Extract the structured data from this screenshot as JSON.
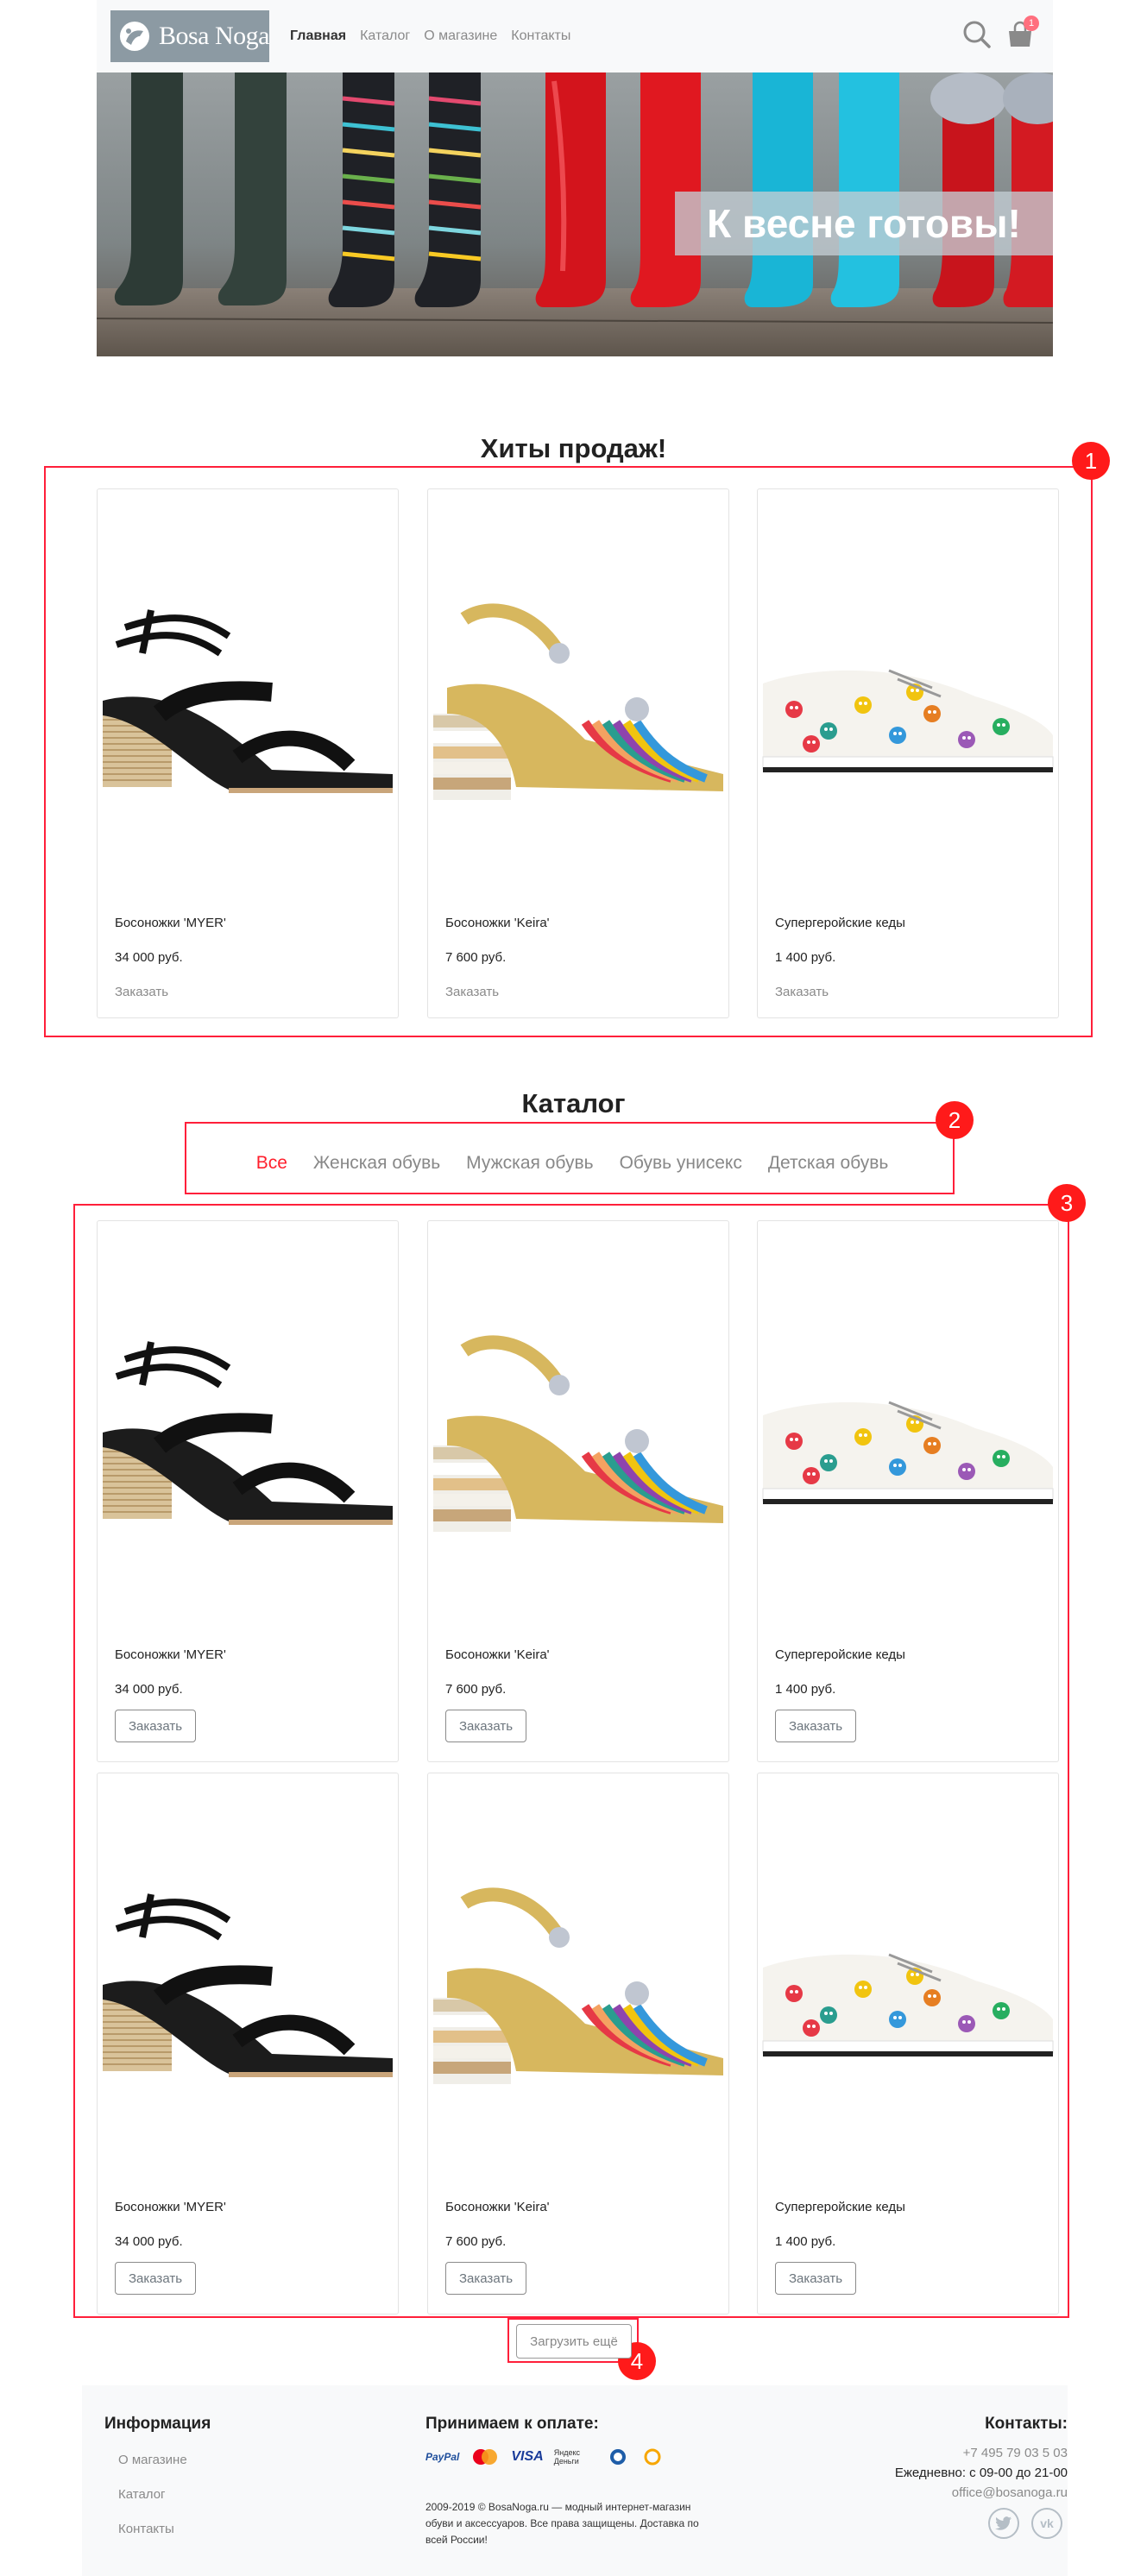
{
  "header": {
    "logo_text": "Bosa Noga",
    "nav": [
      "Главная",
      "Каталог",
      "О магазине",
      "Контакты"
    ],
    "cart_count": "1"
  },
  "banner": {
    "text": "К весне готовы!"
  },
  "bestsellers": {
    "title": "Хиты продаж!",
    "items": [
      {
        "name": "Босоножки 'MYER'",
        "price": "34 000 руб.",
        "order": "Заказать"
      },
      {
        "name": "Босоножки 'Keira'",
        "price": "7 600 руб.",
        "order": "Заказать"
      },
      {
        "name": "Супергеройские кеды",
        "price": "1 400 руб.",
        "order": "Заказать"
      }
    ]
  },
  "catalog": {
    "title": "Каталог",
    "tabs": [
      "Все",
      "Женская обувь",
      "Мужская обувь",
      "Обувь унисекс",
      "Детская обувь"
    ],
    "items": [
      {
        "name": "Босоножки 'MYER'",
        "price": "34 000 руб.",
        "order": "Заказать"
      },
      {
        "name": "Босоножки 'Keira'",
        "price": "7 600 руб.",
        "order": "Заказать"
      },
      {
        "name": "Супергеройские кеды",
        "price": "1 400 руб.",
        "order": "Заказать"
      },
      {
        "name": "Босоножки 'MYER'",
        "price": "34 000 руб.",
        "order": "Заказать"
      },
      {
        "name": "Босоножки 'Keira'",
        "price": "7 600 руб.",
        "order": "Заказать"
      },
      {
        "name": "Супергеройские кеды",
        "price": "1 400 руб.",
        "order": "Заказать"
      }
    ],
    "load_more": "Загрузить ещё"
  },
  "annotations": [
    "1",
    "2",
    "3",
    "4"
  ],
  "footer": {
    "info_title": "Информация",
    "info_links": [
      "О магазине",
      "Каталог",
      "Контакты"
    ],
    "payment_title": "Принимаем к оплате:",
    "payment_methods": [
      "PayPal",
      "MasterCard",
      "VISA",
      "Яндекс Деньги",
      "WebMoney",
      "QIWI"
    ],
    "copyright": "2009-2019 © BosaNoga.ru — модный интернет-магазин обуви и аксессуаров. Все права защищены. Доставка по всей России!",
    "contacts_title": "Контакты:",
    "phone": "+7 495 79 03 5 03",
    "hours": "Ежедневно: с 09-00 до 21-00",
    "email": "office@bosanoga.ru"
  },
  "colors": {
    "accent": "#ff1f2c",
    "annotation": "#ff1a1a",
    "logo_bg": "#8c9aa3"
  }
}
